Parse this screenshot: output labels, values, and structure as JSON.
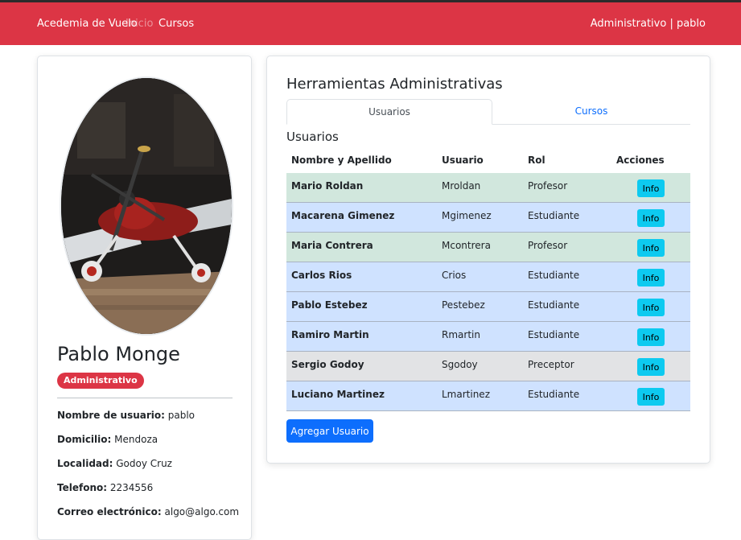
{
  "navbar": {
    "brand": "Acedemia de Vuelo",
    "links": [
      "Inicio",
      "Cursos"
    ],
    "user_label": "Administrativo | pablo"
  },
  "profile": {
    "name": "Pablo Monge",
    "role_badge": "Administrativo",
    "fields": [
      {
        "label": "Nombre de usuario:",
        "value": "pablo"
      },
      {
        "label": "Domicilio:",
        "value": "Mendoza"
      },
      {
        "label": "Localidad:",
        "value": "Godoy Cruz"
      },
      {
        "label": "Telefono:",
        "value": "2234556"
      },
      {
        "label": "Correo electrónico:",
        "value": "algo@algo.com"
      }
    ]
  },
  "admin": {
    "title": "Herramientas Administrativas",
    "tabs": [
      "Usuarios",
      "Cursos"
    ],
    "section_title": "Usuarios",
    "columns": [
      "Nombre y Apellido",
      "Usuario",
      "Rol",
      "Acciones"
    ],
    "rows": [
      {
        "name": "Mario Roldan",
        "user": "Mroldan",
        "rol": "Profesor",
        "action": "Info"
      },
      {
        "name": "Macarena Gimenez",
        "user": "Mgimenez",
        "rol": "Estudiante",
        "action": "Info"
      },
      {
        "name": "Maria Contrera",
        "user": "Mcontrera",
        "rol": "Profesor",
        "action": "Info"
      },
      {
        "name": "Carlos Rios",
        "user": "Crios",
        "rol": "Estudiante",
        "action": "Info"
      },
      {
        "name": "Pablo Estebez",
        "user": "Pestebez",
        "rol": "Estudiante",
        "action": "Info"
      },
      {
        "name": "Ramiro Martin",
        "user": "Rmartin",
        "rol": "Estudiante",
        "action": "Info"
      },
      {
        "name": "Sergio Godoy",
        "user": "Sgodoy",
        "rol": "Preceptor",
        "action": "Info"
      },
      {
        "name": "Luciano Martinez",
        "user": "Lmartinez",
        "rol": "Estudiante",
        "action": "Info"
      }
    ],
    "add_button": "Agregar Usuario"
  },
  "colors": {
    "navbar": "#dc3545",
    "row_profesor": "#d1e7dd",
    "row_estudiante": "#cfe2ff",
    "row_preceptor": "#e2e3e5",
    "info_button": "#0dcaf0",
    "primary_button": "#0d6efd"
  }
}
